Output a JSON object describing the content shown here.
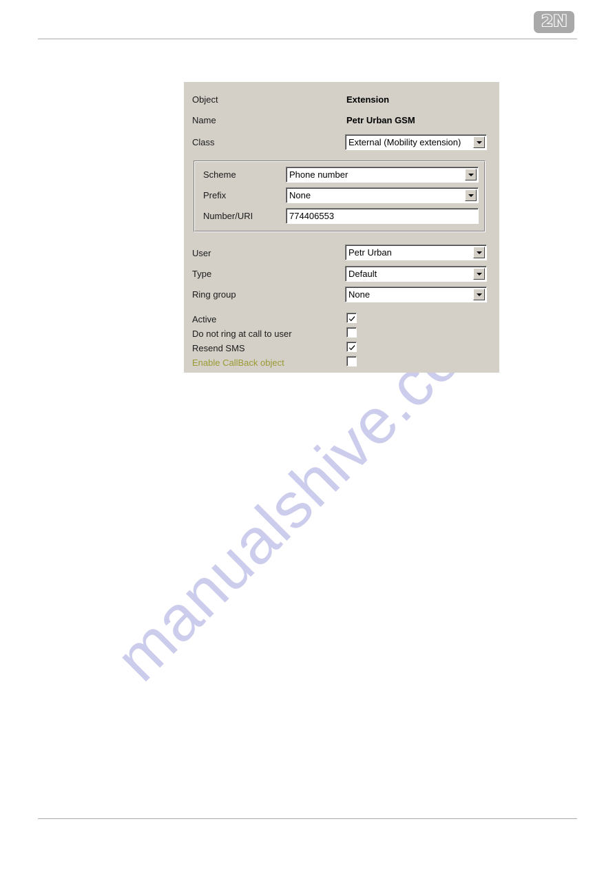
{
  "header": {
    "logo_text": "2N"
  },
  "watermark": {
    "text": "manualshive.com"
  },
  "dialog": {
    "fields": [
      {
        "label": "Object",
        "value": "Extension",
        "type": "static-bold"
      },
      {
        "label": "Name",
        "value": "Petr Urban GSM",
        "type": "static-bold"
      },
      {
        "label": "Class",
        "value": "External (Mobility extension)",
        "type": "combo"
      }
    ],
    "group": {
      "fields": [
        {
          "label": "Scheme",
          "value": "Phone number",
          "type": "combo"
        },
        {
          "label": "Prefix",
          "value": "None",
          "type": "combo"
        },
        {
          "label": "Number/URI",
          "value": "774406553",
          "type": "text"
        }
      ]
    },
    "fields2": [
      {
        "label": "User",
        "value": "Petr Urban",
        "type": "combo"
      },
      {
        "label": "Type",
        "value": "Default",
        "type": "combo"
      },
      {
        "label": "Ring group",
        "value": "None",
        "type": "combo"
      }
    ],
    "checkboxes": [
      {
        "label": "Active",
        "checked": true,
        "disabled": false
      },
      {
        "label": "Do not ring at call to user",
        "checked": false,
        "disabled": false
      },
      {
        "label": "Resend SMS",
        "checked": true,
        "disabled": false
      },
      {
        "label": "Enable CallBack object",
        "checked": false,
        "disabled": true
      }
    ]
  },
  "colors": {
    "dialog_background": "#d4d0c8",
    "disabled_label": "#9a9a33",
    "watermark": "#ccccec",
    "logo_background": "#a9a9a9",
    "rule": "#a9a9a9"
  }
}
